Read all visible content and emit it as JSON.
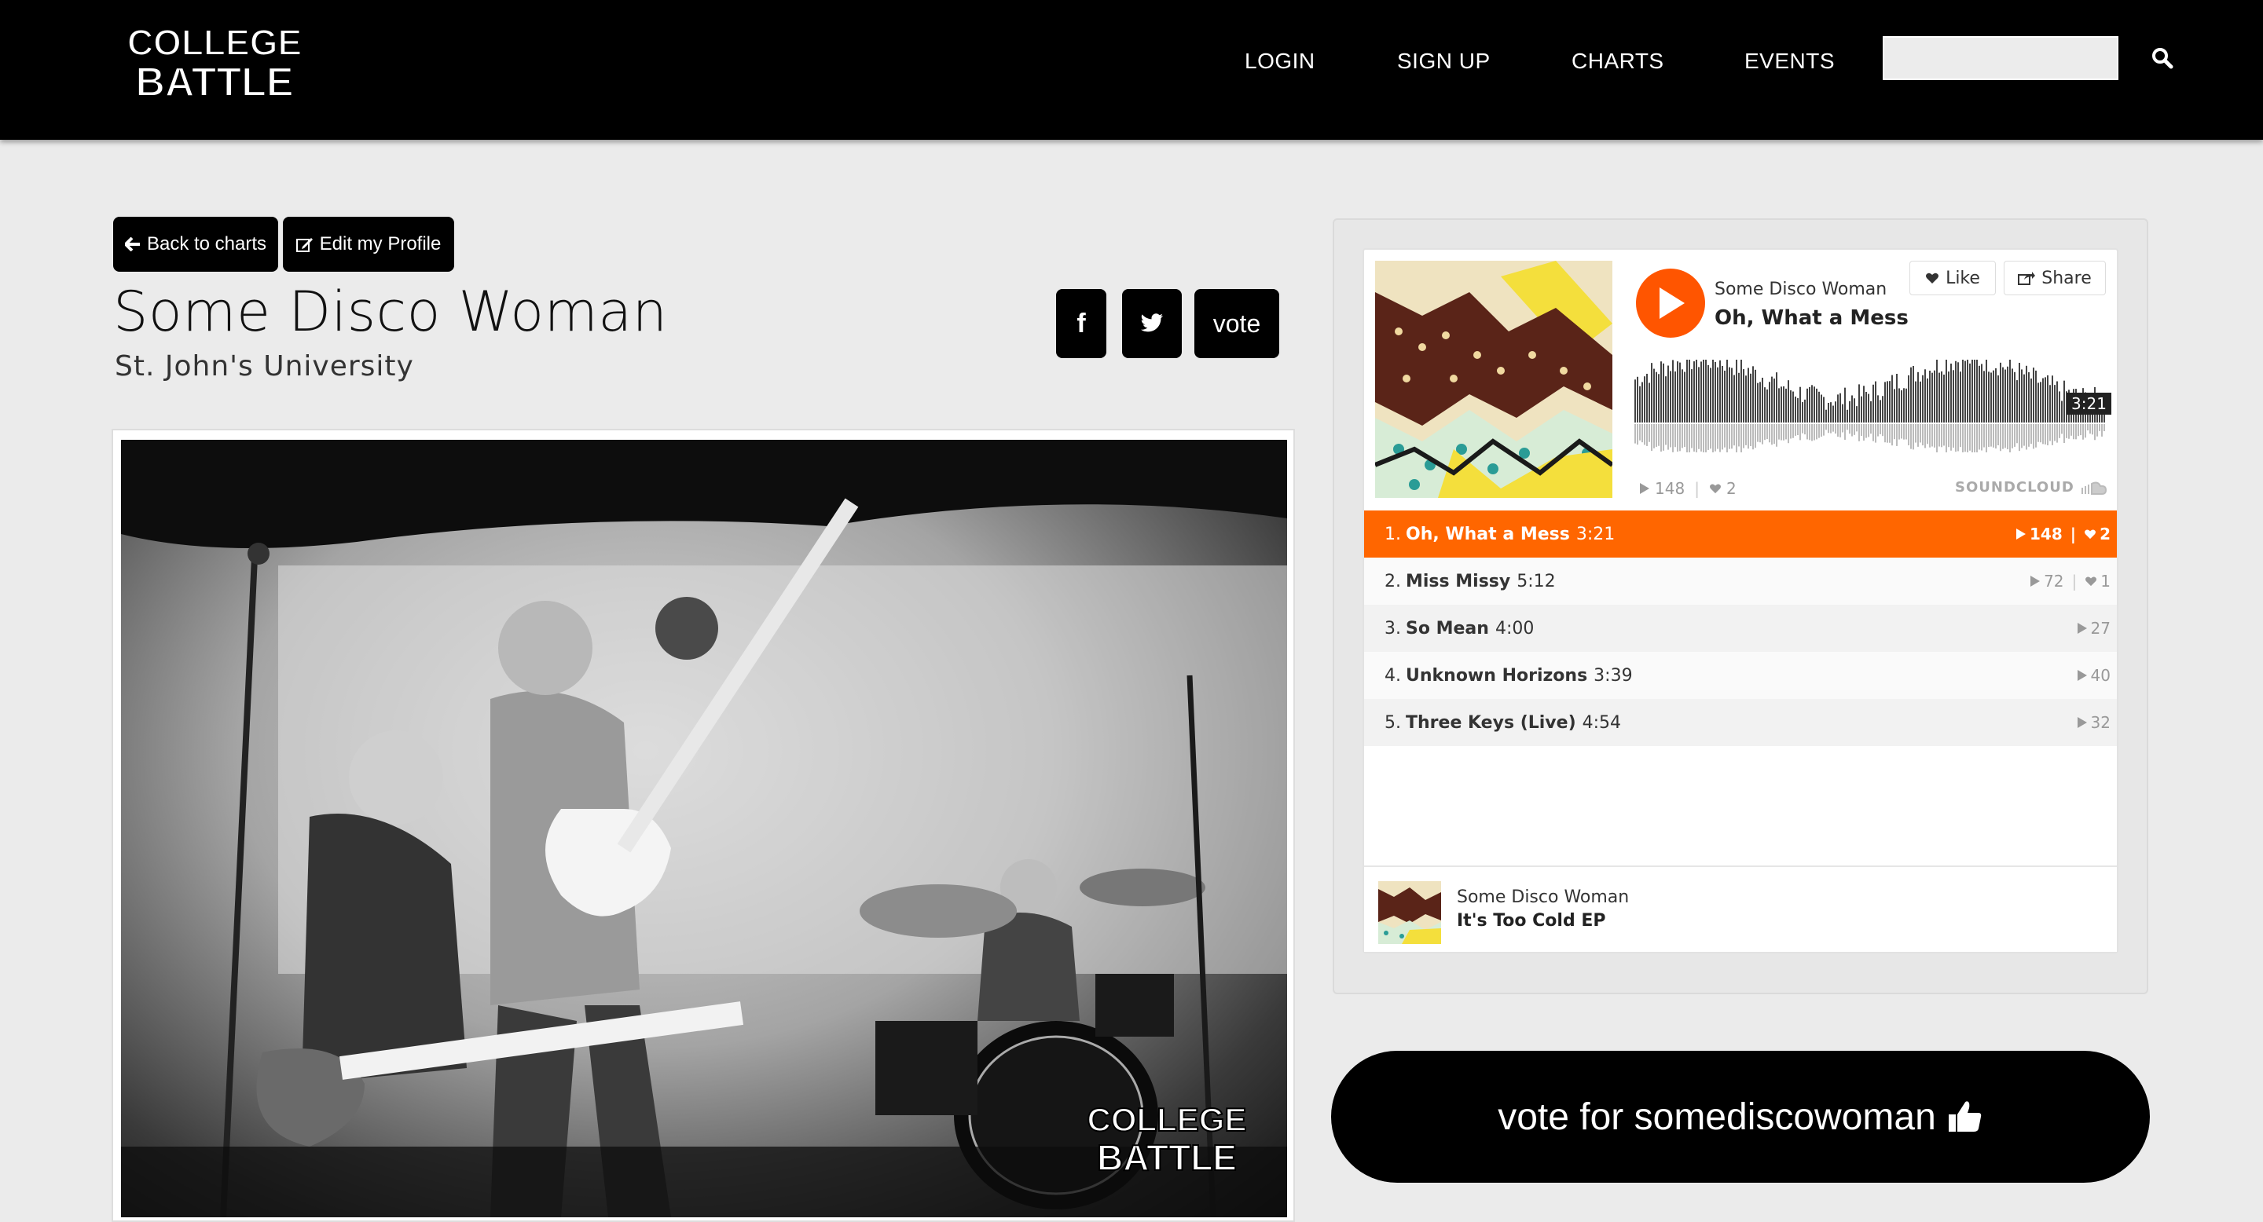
{
  "nav": {
    "logo_line1": "COLLEGE",
    "logo_line2": "BATTLE",
    "links": [
      "LOGIN",
      "SIGN UP",
      "CHARTS",
      "EVENTS"
    ],
    "search_placeholder": ""
  },
  "actions": {
    "back_label": "Back to charts",
    "edit_label": "Edit my Profile"
  },
  "band": {
    "name": "Some Disco Woman",
    "school": "St. John's University"
  },
  "social": {
    "facebook": "f",
    "vote_label": "vote"
  },
  "player": {
    "artist": "Some Disco Woman",
    "track": "Oh, What a Mess",
    "like_label": "Like",
    "share_label": "Share",
    "duration": "3:21",
    "plays": "148",
    "likes": "2",
    "brand": "SOUNDCLOUD",
    "progress": 0.0,
    "tracks": [
      {
        "num": "1.",
        "title": "Oh, What a Mess",
        "time": "3:21",
        "plays": "148",
        "likes": "2",
        "active": true
      },
      {
        "num": "2.",
        "title": "Miss Missy",
        "time": "5:12",
        "plays": "72",
        "likes": "1",
        "active": false
      },
      {
        "num": "3.",
        "title": "So Mean",
        "time": "4:00",
        "plays": "27",
        "likes": "",
        "active": false
      },
      {
        "num": "4.",
        "title": "Unknown Horizons",
        "time": "3:39",
        "plays": "40",
        "likes": "",
        "active": false
      },
      {
        "num": "5.",
        "title": "Three Keys (Live)",
        "time": "4:54",
        "plays": "32",
        "likes": "",
        "active": false
      }
    ],
    "album": {
      "artist": "Some Disco Woman",
      "title": "It's Too Cold EP"
    }
  },
  "vote_big_label": "vote for somediscowoman",
  "photo_watermark": {
    "line1": "COLLEGE",
    "line2": "BATTLE"
  },
  "colors": {
    "accent": "#ff5500",
    "active_row": "#ff6600",
    "background": "#ebebeb"
  }
}
